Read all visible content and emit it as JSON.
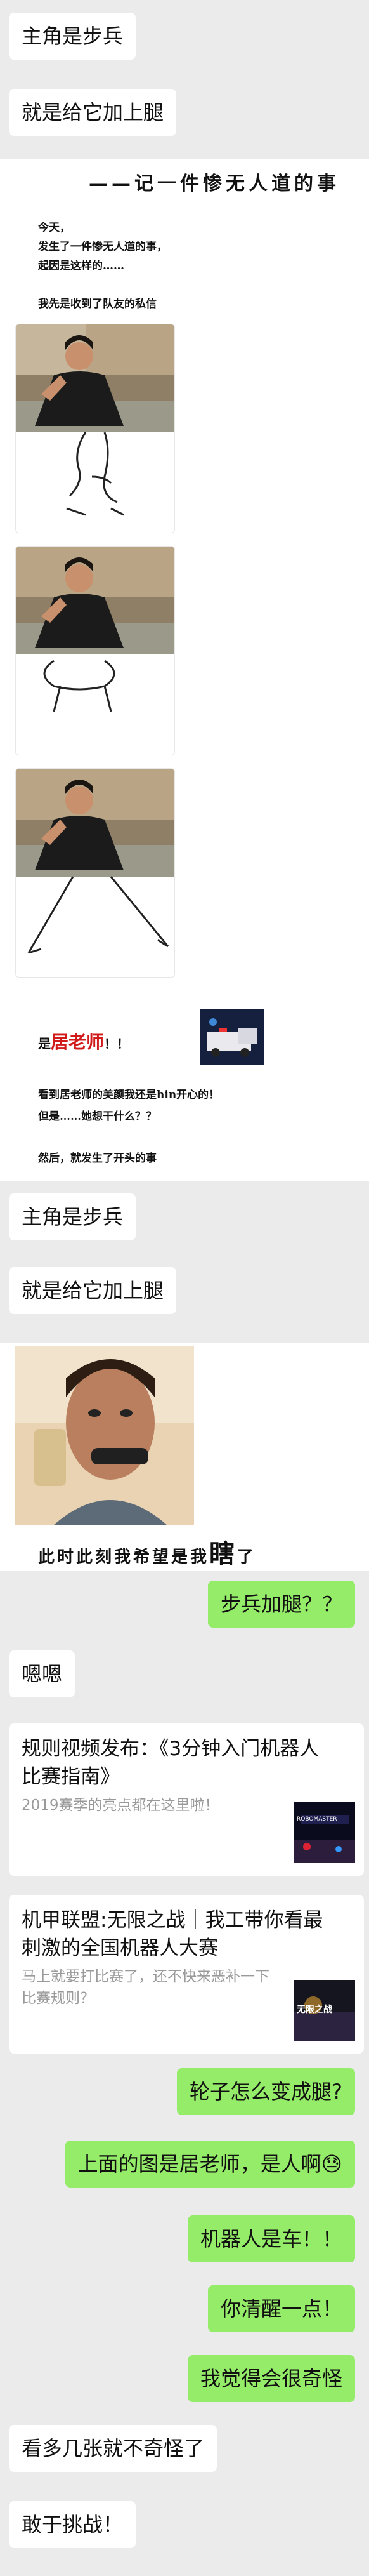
{
  "messages_top": {
    "m1": "主角是步兵",
    "m2": "就是给它加上腿"
  },
  "story": {
    "title": "——记一件惨无人道的事",
    "line1": "今天，",
    "line2": "发生了一件惨无人道的事，",
    "line3": "起因是这样的……",
    "line4": "我先是收到了队友的私信"
  },
  "story2": {
    "line_a_prefix": "是",
    "line_a_emph": "居老师",
    "line_a_suffix": "！！",
    "line_b": "看到居老师的美颜我还是hin开心的！",
    "line_c": "但是……她想干什么？？",
    "line_d": "然后，就发生了开头的事"
  },
  "messages_mid": {
    "m1": "主角是步兵",
    "m2": "就是给它加上腿"
  },
  "photo_caption": {
    "prefix": "此时此刻我希望是我",
    "emph": "瞎",
    "suffix": "了"
  },
  "chat": {
    "r1": "步兵加腿？？",
    "l1": "嗯嗯",
    "r2": "轮子怎么变成腿?",
    "r3": "上面的图是居老师，是人啊",
    "r3_emoji": "😓",
    "r4": "机器人是车！！",
    "r5": "你清醒一点！",
    "r6": "我觉得会很奇怪",
    "l2": "看多几张就不奇怪了",
    "l3": "敢于挑战！"
  },
  "cards": [
    {
      "title": "规则视频发布：《3分钟入门机器人比赛指南》",
      "desc": "2019赛季的亮点都在这里啦！",
      "thumb_text": "ROBOMASTER"
    },
    {
      "title": "机甲联盟:无限之战｜我工带你看最刺激的全国机器人大赛",
      "desc": "马上就要打比赛了，还不快来恶补一下比赛规则？",
      "thumb_text": "无限之战"
    }
  ],
  "colors": {
    "chat_bg": "#ebebeb",
    "bubble_self": "#95ec69",
    "bubble_other": "#ffffff",
    "accent_red": "#d11a1a"
  }
}
